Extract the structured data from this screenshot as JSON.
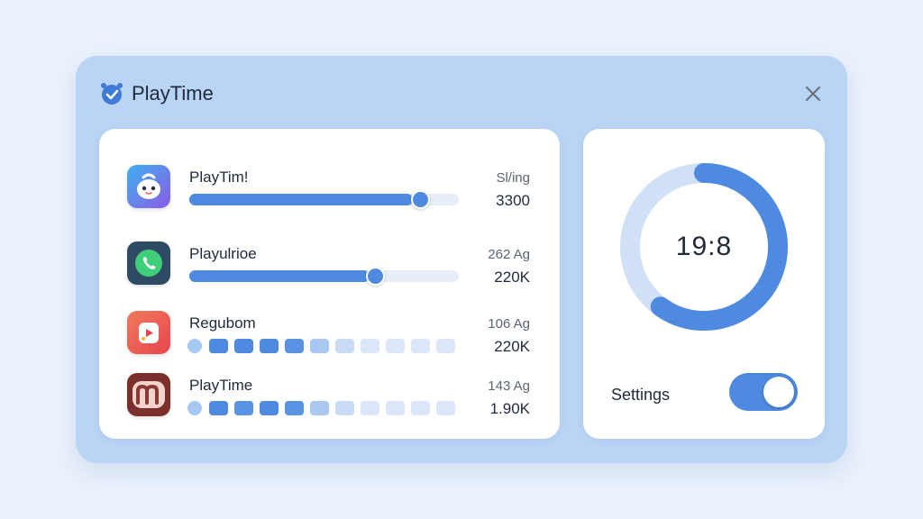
{
  "window": {
    "title": "PlayTime",
    "title_icon": "alarm-clock-check-icon",
    "close_icon": "close-icon"
  },
  "apps": [
    {
      "name": "PlayTim!",
      "stat_top": "Sl/ing",
      "stat_bottom": "3300",
      "icon": "cute-mascot-app-icon",
      "progress": 0.85,
      "bar_style": "slider"
    },
    {
      "name": "Playulrioe",
      "stat_top": "262 Ag",
      "stat_bottom": "220K",
      "icon": "phone-call-app-icon",
      "progress": 0.69,
      "bar_style": "slider"
    },
    {
      "name": "Regubom",
      "stat_top": "106 Ag",
      "stat_bottom": "220K",
      "icon": "play-bag-app-icon",
      "bar_style": "segmented"
    },
    {
      "name": "PlayTime",
      "stat_top": "143 Ag",
      "stat_bottom": "1.90K",
      "icon": "m-logo-app-icon",
      "bar_style": "segmented"
    }
  ],
  "timer": {
    "display": "19:8",
    "ring_progress": 0.6
  },
  "settings": {
    "label": "Settings",
    "toggle_on": true
  },
  "colors": {
    "accent": "#4d8ae0",
    "window_bg": "#b9d4f5",
    "page_bg": "#ebf2fc"
  }
}
